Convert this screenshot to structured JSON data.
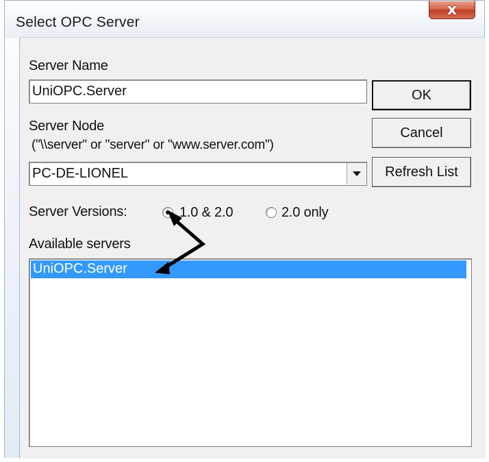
{
  "window": {
    "title": "Select OPC Server",
    "close_label": "x"
  },
  "server_name": {
    "label": "Server Name",
    "value": "UniOPC.Server"
  },
  "server_node": {
    "label": "Server Node",
    "hint": "(\"\\\\server\" or \"server\" or \"www.server.com\")",
    "value": "PC-DE-LIONEL"
  },
  "buttons": {
    "ok": "OK",
    "cancel": "Cancel",
    "refresh": "Refresh List"
  },
  "server_versions": {
    "label": "Server Versions:",
    "options": [
      {
        "label": "1.0 & 2.0",
        "selected": true
      },
      {
        "label": "2.0 only",
        "selected": false
      }
    ]
  },
  "available_servers": {
    "label": "Available servers",
    "items": [
      {
        "label": "UniOPC.Server",
        "selected": true
      }
    ]
  },
  "colors": {
    "selection": "#3399ff",
    "dialog_background": "#f0f0f0",
    "close_button": "#c3412a"
  },
  "icons": {
    "close": "close-icon",
    "dropdown": "chevron-down-icon",
    "annotation": "arrow-annotation"
  }
}
